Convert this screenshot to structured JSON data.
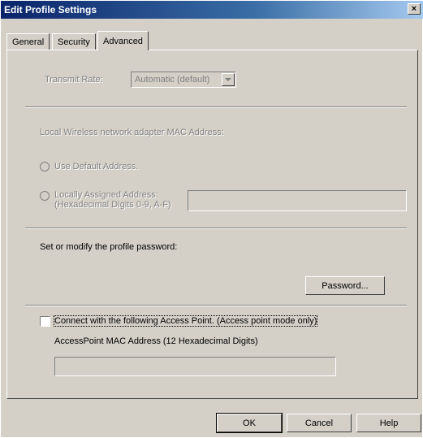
{
  "window": {
    "title": "Edit Profile Settings",
    "close_glyph": "×"
  },
  "tabs": [
    {
      "label": "General"
    },
    {
      "label": "Security"
    },
    {
      "label": "Advanced"
    }
  ],
  "advanced": {
    "transmit_rate_label": "Transmit Rate:",
    "transmit_rate_value": "Automatic (default)",
    "mac_heading": "Local Wireless network adapter MAC Address:",
    "use_default_label": "Use Default Address.",
    "locally_assigned_line1": "Locally Assigned Address:",
    "locally_assigned_line2": "(Hexadecimal Digits 0-9, A-F)",
    "password_heading": "Set or modify the profile password:",
    "password_button": "Password...",
    "connect_ap_label": "Connect with the following Access Point. (Access point mode only)",
    "ap_mac_label": "AccessPoint MAC Address (12 Hexadecimal Digits)"
  },
  "buttons": {
    "ok": "OK",
    "cancel": "Cancel",
    "help": "Help"
  },
  "colors": {
    "face": "#d4d0c8",
    "title_start": "#0a246a",
    "title_end": "#a6caf0",
    "disabled_text": "#808080"
  },
  "icons": {
    "close": "close-icon",
    "dropdown": "chevron-down-icon"
  }
}
